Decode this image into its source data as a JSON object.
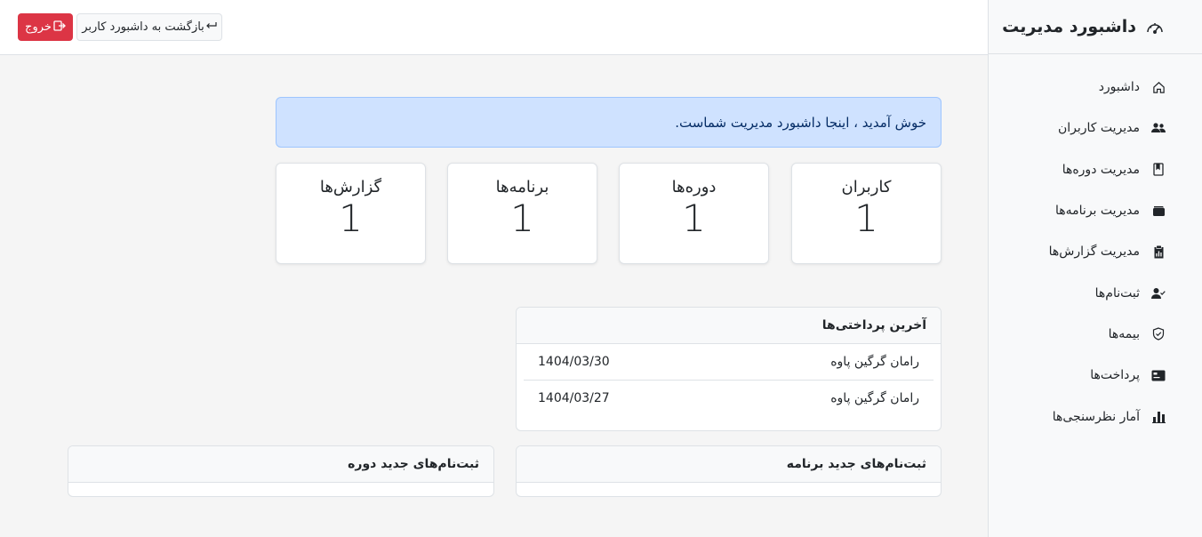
{
  "sidebar": {
    "brand": {
      "title": "داشبورد مدیریت",
      "icon": "speedometer-icon"
    },
    "items": [
      {
        "label": "داشبورد",
        "icon": "house-icon"
      },
      {
        "label": "مدیریت کاربران",
        "icon": "people-icon"
      },
      {
        "label": "مدیریت دوره‌ها",
        "icon": "journal-icon"
      },
      {
        "label": "مدیریت برنامه‌ها",
        "icon": "wallet-icon"
      },
      {
        "label": "مدیریت گزارش‌ها",
        "icon": "clipboard-data-icon"
      },
      {
        "label": "ثبت‌نام‌ها",
        "icon": "person-check-icon"
      },
      {
        "label": "بیمه‌ها",
        "icon": "shield-check-icon"
      },
      {
        "label": "پرداخت‌ها",
        "icon": "credit-card-icon"
      },
      {
        "label": "آمار نظرسنجی‌ها",
        "icon": "bar-chart-icon"
      }
    ]
  },
  "topbar": {
    "logout_label": "خروج",
    "back_label": "بازگشت به داشبورد کاربر"
  },
  "welcome": {
    "message": "خوش آمدید ، اینجا داشبورد مدیریت شماست."
  },
  "stats": [
    {
      "title": "کاربران",
      "value": "1"
    },
    {
      "title": "دوره‌ها",
      "value": "1"
    },
    {
      "title": "برنامه‌ها",
      "value": "1"
    },
    {
      "title": "گزارش‌ها",
      "value": "1"
    }
  ],
  "payments": {
    "title": "آخرین پرداختی‌ها",
    "rows": [
      {
        "name": "رامان گرگین پاوه",
        "date": "1404/03/30"
      },
      {
        "name": "رامان گرگین پاوه",
        "date": "1404/03/27"
      }
    ]
  },
  "program_signups": {
    "title": "ثبت‌نام‌های جدید برنامه"
  },
  "course_signups": {
    "title": "ثبت‌نام‌های جدید دوره"
  },
  "colors": {
    "danger": "#dc3545",
    "alert_bg": "#cfe2ff",
    "alert_text": "#052c65"
  }
}
